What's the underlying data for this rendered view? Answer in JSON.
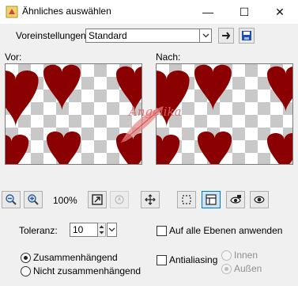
{
  "window": {
    "title": "Ähnliches auswählen",
    "minimize_label": "—",
    "maximize_label": "☐",
    "close_label": "✕"
  },
  "presets": {
    "label": "Voreinstellungen:",
    "value": "Standard"
  },
  "preview": {
    "before_label": "Vor:",
    "after_label": "Nach:",
    "watermark": "Angelika",
    "heart_color": "#8b0000"
  },
  "zoom": {
    "level": "100%"
  },
  "tolerance": {
    "label": "Toleranz:",
    "value": "10"
  },
  "options": {
    "all_layers_label": "Auf alle Ebenen anwenden",
    "antialiasing_label": "Antialiasing",
    "inside_label": "Innen",
    "outside_label": "Außen",
    "contiguous_label": "Zusammenhängend",
    "non_contiguous_label": "Nicht zusammenhängend"
  },
  "icons": {
    "app": "app-icon",
    "save_preset": "save-icon",
    "load_preset": "undo-icon",
    "zoom_out": "zoom-out-icon",
    "zoom_in": "zoom-in-icon",
    "fit": "fit-window-icon",
    "navigate": "navigate-icon",
    "pan": "pan-icon",
    "marquee": "selection-marquee-icon",
    "layout": "layout-icon",
    "proof": "proof-icon",
    "eye": "eye-icon"
  },
  "colors": {
    "accent": "#0078d7"
  }
}
